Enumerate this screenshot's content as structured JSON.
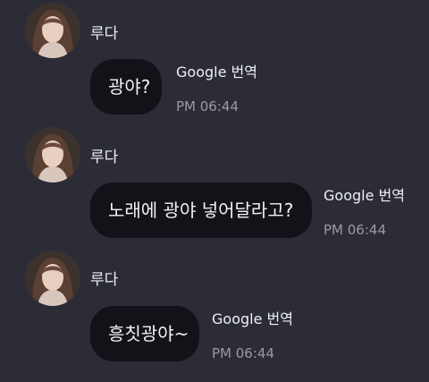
{
  "messages": [
    {
      "sender": "루다",
      "text": "광야?",
      "translate_label": "Google 번역",
      "time": "PM 06:44"
    },
    {
      "sender": "루다",
      "text": "노래에 광야 넣어달라고?",
      "translate_label": "Google 번역",
      "time": "PM 06:44"
    },
    {
      "sender": "루다",
      "text": "흥칫광야~",
      "translate_label": "Google 번역",
      "time": "PM 06:44"
    }
  ],
  "colors": {
    "background": "#2b2c36",
    "bubble": "#121318",
    "timestamp": "#9a9aa6"
  }
}
